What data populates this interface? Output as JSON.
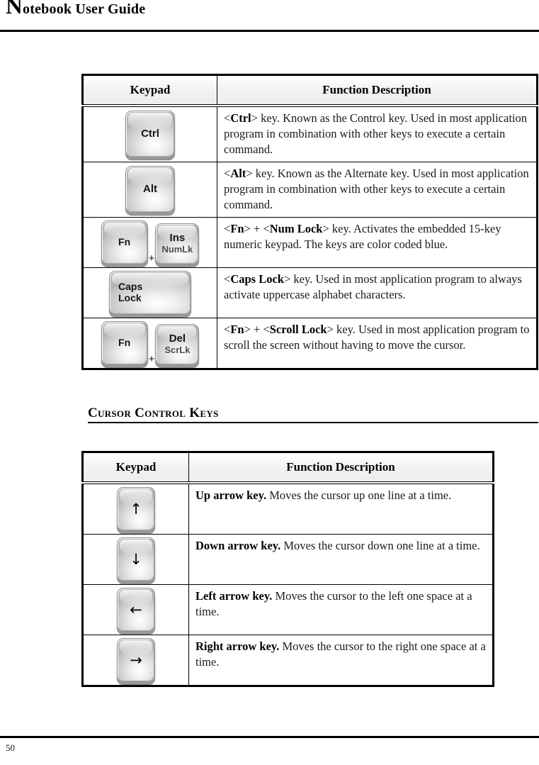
{
  "header": {
    "title_dropcap": "N",
    "title_rest": "otebook User Guide"
  },
  "tables": {
    "modifier_keys": {
      "columns": [
        "Keypad",
        "Function Description"
      ],
      "rows": [
        {
          "keys": [
            {
              "type": "square",
              "line1": "Ctrl"
            }
          ],
          "desc_prefix": "<",
          "desc_bold": "Ctrl",
          "desc_rest": "> key. Known as the Control key. Used in most application program in combination with other keys to execute a certain command.",
          "desc_full": "<Ctrl> key. Known as the Control key. Used in most application program in combination with other keys to execute a certain command."
        },
        {
          "keys": [
            {
              "type": "square",
              "line1": "Alt"
            }
          ],
          "desc_full": "<Alt> key. Known as the Alternate key. Used in most application program in combination with other keys to execute a certain command."
        },
        {
          "keys": [
            {
              "type": "fn",
              "line1": "Fn"
            },
            {
              "type": "plus",
              "line1": "+"
            },
            {
              "type": "dual",
              "line1": "Ins",
              "line2": "NumLk"
            }
          ],
          "desc_full": "<Fn> + <Num Lock> key. Activates the embedded 15-key numeric keypad. The keys are color coded blue."
        },
        {
          "keys": [
            {
              "type": "wide",
              "line1": "Caps",
              "line2": "Lock"
            }
          ],
          "desc_full": "<Caps Lock> key. Used in most application program to always activate uppercase alphabet characters."
        },
        {
          "keys": [
            {
              "type": "fn",
              "line1": "Fn"
            },
            {
              "type": "plus",
              "line1": "+"
            },
            {
              "type": "dual",
              "line1": "Del",
              "line2": "ScrLk"
            }
          ],
          "desc_full": "<Fn> + <Scroll Lock> key. Used in most application program to scroll the screen without having to move the cursor."
        }
      ]
    },
    "cursor_keys": {
      "columns": [
        "Keypad",
        "Function Description"
      ],
      "rows": [
        {
          "key_icon": "up-arrow-key",
          "glyph": "↑",
          "desc_bold": "Up arrow key.",
          "desc_rest": " Moves the cursor up one line at a time."
        },
        {
          "key_icon": "down-arrow-key",
          "glyph": "↓",
          "desc_bold": "Down arrow key.",
          "desc_rest": " Moves the cursor down one line at a time."
        },
        {
          "key_icon": "left-arrow-key",
          "glyph": "←",
          "desc_bold": "Left arrow key.",
          "desc_rest": " Moves the cursor to the left one space at a time."
        },
        {
          "key_icon": "right-arrow-key",
          "glyph": "→",
          "desc_bold": "Right arrow key.",
          "desc_rest": " Moves the cursor to the right one space at a time."
        }
      ]
    }
  },
  "section_heading": {
    "text": "Cursor Control Keys"
  },
  "footer": {
    "page_number": "50"
  },
  "colors": {
    "rule": "#000000",
    "header_row_bg": "#f0f0f0",
    "keycap_light": "#ffffff",
    "keycap_mid": "#dcdcdc",
    "keycap_dark": "#b4b4b4",
    "keycap_border": "#8e8e8e",
    "text": "#1a1a1a"
  }
}
